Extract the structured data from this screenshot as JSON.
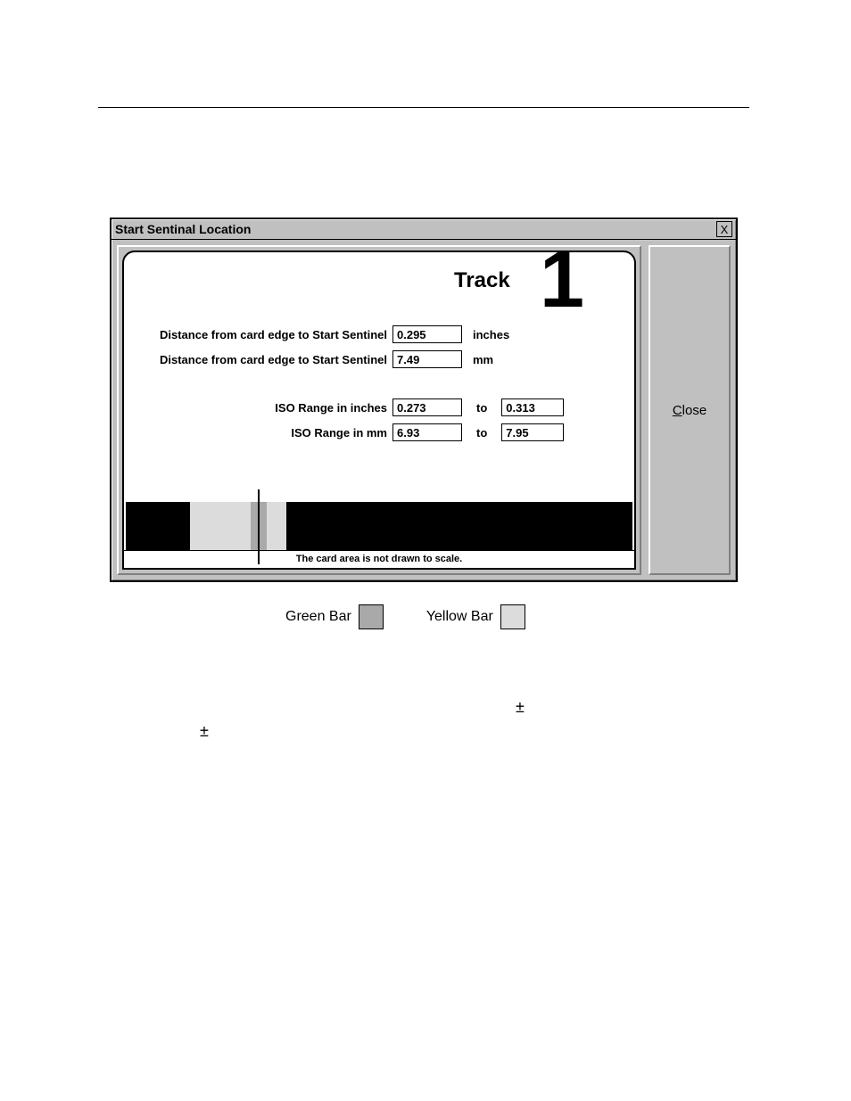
{
  "dialog": {
    "title": "Start Sentinal Location",
    "track_label": "Track",
    "track_number": "1",
    "rows": {
      "dist_in_label": "Distance from card edge to Start Sentinel",
      "dist_in_value": "0.295",
      "dist_in_unit": "inches",
      "dist_mm_label": "Distance from card edge to Start Sentinel",
      "dist_mm_value": "7.49",
      "dist_mm_unit": "mm",
      "iso_in_label": "ISO Range in inches",
      "iso_in_from": "0.273",
      "iso_in_to": "0.313",
      "iso_mm_label": "ISO Range in mm",
      "iso_mm_from": "6.93",
      "iso_mm_to": "7.95",
      "to_label": "to"
    },
    "footer_note": "The card area is not drawn to scale.",
    "close_button": "Close",
    "close_underline_char": "C"
  },
  "legend": {
    "green_label": "Green Bar",
    "yellow_label": "Yellow Bar"
  },
  "symbols": {
    "plusminus1": "±",
    "plusminus2": "±"
  }
}
